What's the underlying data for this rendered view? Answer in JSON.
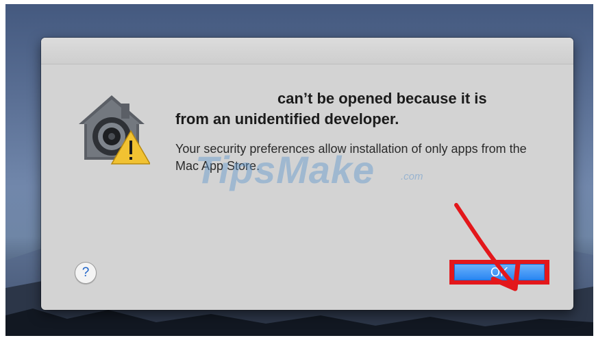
{
  "dialog": {
    "title_line1": "can’t be opened because it is",
    "title_line2": "from an unidentified developer.",
    "message": "Your security preferences allow installation of only apps from the Mac App Store.",
    "ok_label": "OK",
    "help_label": "?"
  },
  "watermark": {
    "text": "TipsMake",
    "suffix": ".com"
  },
  "icons": {
    "app_icon": "gatekeeper-lock-icon",
    "warning_badge": "warning-triangle-icon",
    "annotation": "red-arrow-annotation"
  },
  "colors": {
    "dialog_bg": "#d3d3d3",
    "ok_button": "#2a86f2",
    "highlight": "#e3171b",
    "help_glyph": "#1e63c8"
  }
}
